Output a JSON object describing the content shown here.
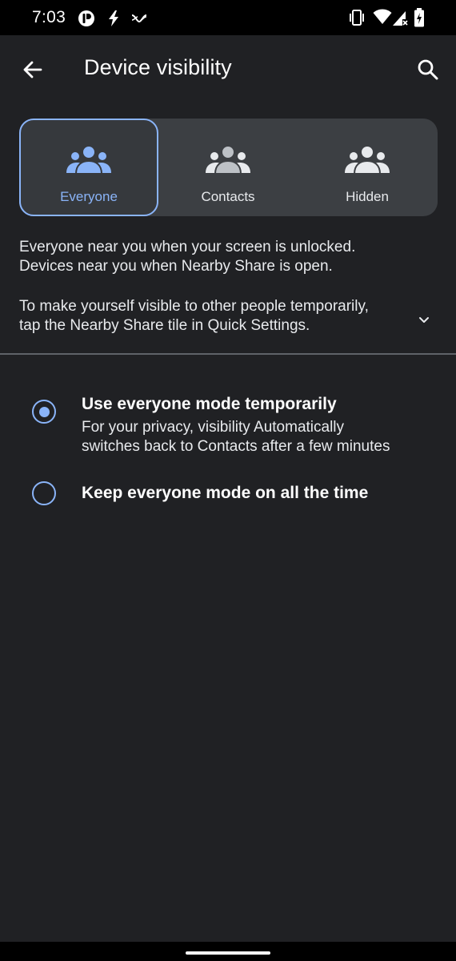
{
  "status_bar": {
    "time": "7:03",
    "left_icons": [
      "app-notification-icon",
      "lightning-icon",
      "data-saver-icon"
    ],
    "right_icons": [
      "vibrate-icon",
      "wifi-icon",
      "cellular-no-signal-icon",
      "battery-charging-icon"
    ]
  },
  "app_bar": {
    "title": "Device visibility",
    "back_icon": "arrow-back-icon",
    "search_icon": "search-icon"
  },
  "visibility_options": {
    "selected": "Everyone",
    "items": [
      {
        "label": "Everyone",
        "icon": "group-icon",
        "selected": true
      },
      {
        "label": "Contacts",
        "icon": "group-icon",
        "selected": false
      },
      {
        "label": "Hidden",
        "icon": "group-icon",
        "selected": false
      }
    ]
  },
  "description": {
    "line1": "Everyone near you when your screen is unlocked.",
    "line2": "Devices near you when Nearby Share is open.",
    "line3": "To make yourself visible to other people temporarily,",
    "line4": "tap the Nearby Share tile in Quick Settings.",
    "expand_icon": "chevron-down-icon"
  },
  "mode_options": [
    {
      "title": "Use everyone mode temporarily",
      "subtitle_line1": "For your privacy, visibility Automatically",
      "subtitle_line2": "switches back to Contacts after a few minutes",
      "checked": true
    },
    {
      "title": "Keep everyone mode on all the time",
      "checked": false
    }
  ],
  "colors": {
    "accent": "#8ab4f8",
    "background": "#202124",
    "segment_bg": "#3c3f43",
    "divider": "#5f6368"
  }
}
